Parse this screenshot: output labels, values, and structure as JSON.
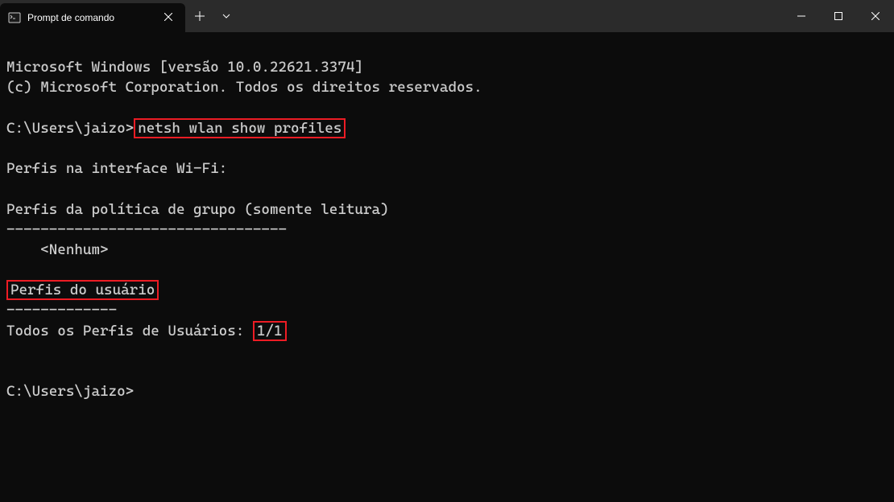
{
  "titlebar": {
    "tab_title": "Prompt de comando"
  },
  "terminal": {
    "line1": "Microsoft Windows [versão 10.0.22621.3374]",
    "line2": "(c) Microsoft Corporation. Todos os direitos reservados.",
    "prompt1": "C:\\Users\\jaizo>",
    "command": "netsh wlan show profiles",
    "section_header": "Perfis na interface Wi-Fi:",
    "group_policy_header": "Perfis da política de grupo (somente leitura)",
    "group_policy_divider": "---------------------------------",
    "group_policy_none": "    <Nenhum>",
    "user_profiles_header": "Perfis do usuário",
    "user_profiles_divider": "-------------",
    "profile_entry_label": "Todos os Perfis de Usuários: ",
    "profile_entry_value": "1/1",
    "prompt2": "C:\\Users\\jaizo>"
  }
}
